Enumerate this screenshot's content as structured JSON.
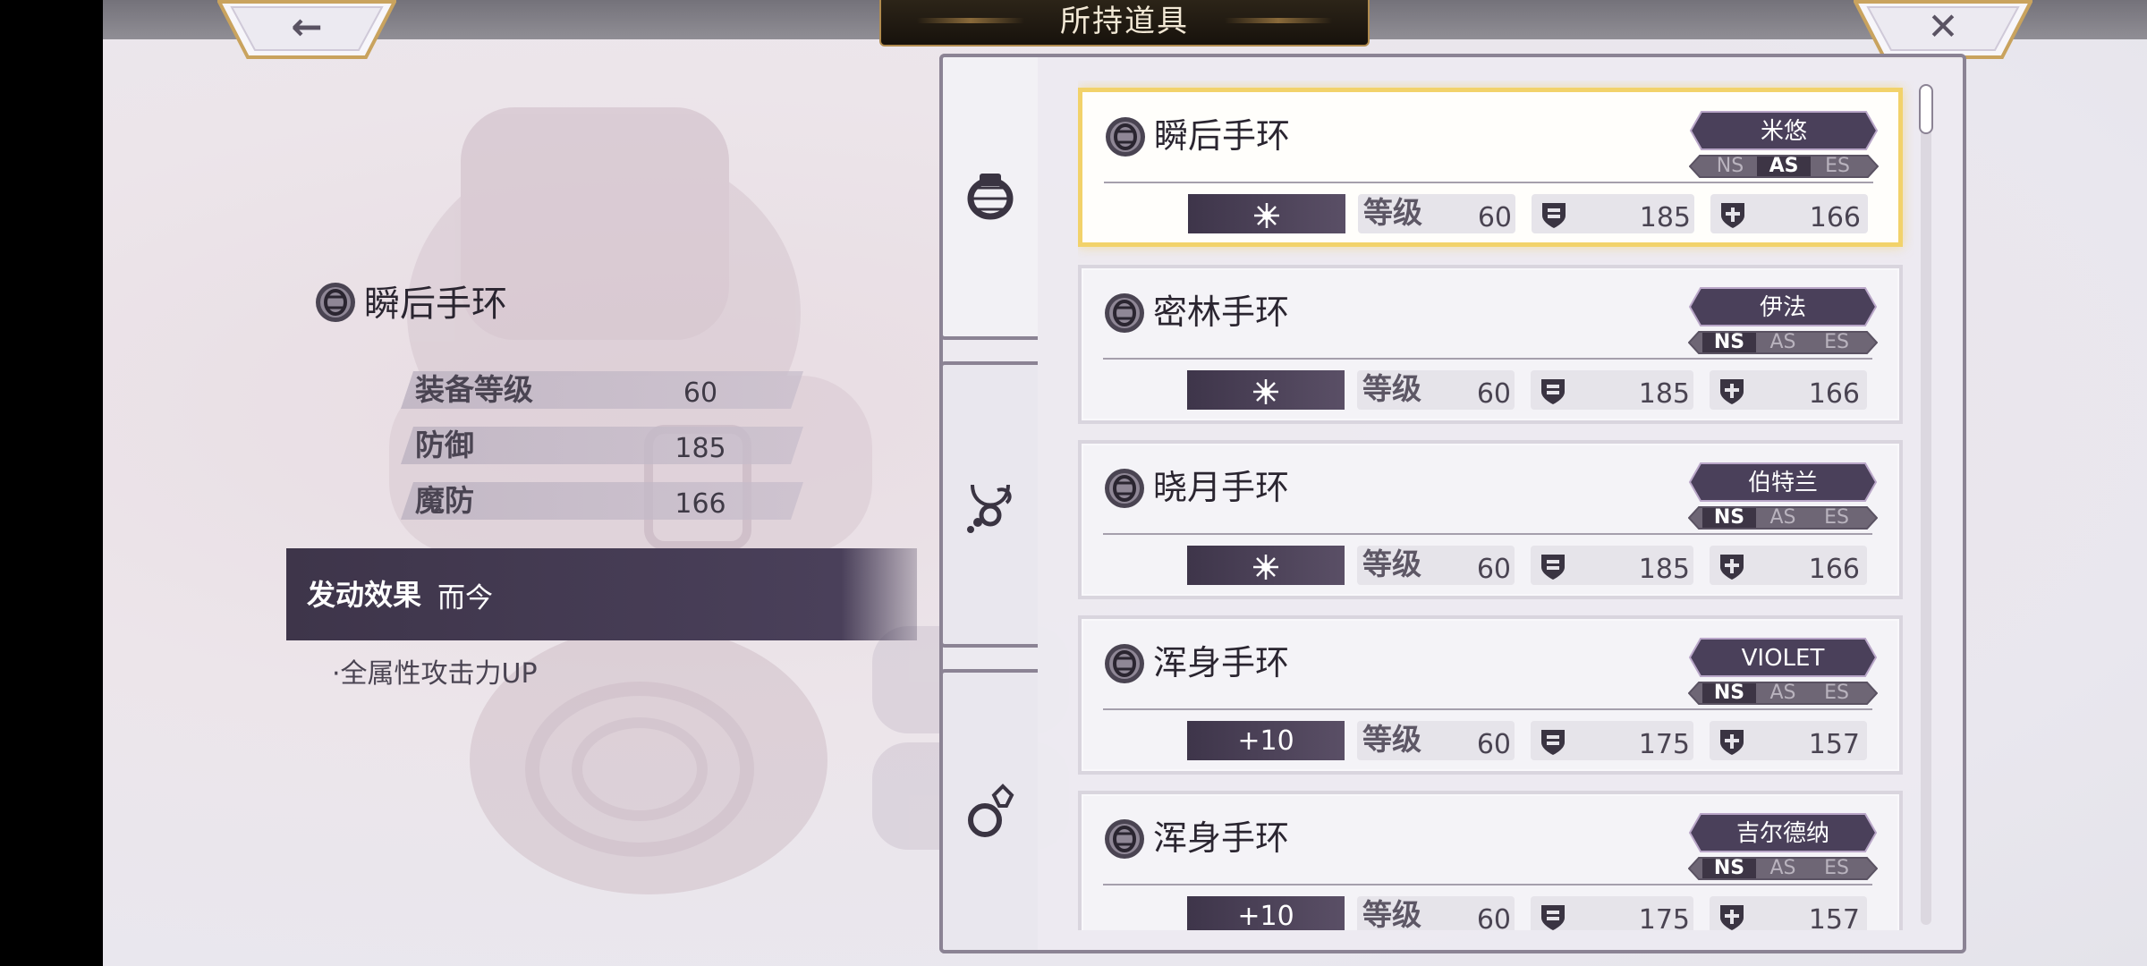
{
  "title": "所持道具",
  "nav": {
    "back_icon": "back-arrow-icon",
    "close_icon": "close-icon",
    "back_glyph": "←",
    "close_glyph": "✕"
  },
  "detail": {
    "name": "瞬后手环",
    "icon": "bracelet-icon",
    "stats": [
      {
        "label": "装备等级",
        "value": "60"
      },
      {
        "label": "防御",
        "value": "185"
      },
      {
        "label": "魔防",
        "value": "166"
      }
    ],
    "effect_label": "发动效果",
    "effect_value": "而今",
    "effect_desc": "·全属性攻击力UP"
  },
  "tabs": [
    {
      "icon": "bracelet-icon",
      "active": true
    },
    {
      "icon": "necklace-icon",
      "active": false
    },
    {
      "icon": "ring-icon",
      "active": false
    }
  ],
  "list": {
    "level_label": "等级",
    "ns": "NS",
    "as": "AS",
    "es": "ES",
    "items": [
      {
        "name": "瞬后手环",
        "owner": "米悠",
        "active_style": "AS",
        "refine": "",
        "refine_icon": "sparkle-icon",
        "level": "60",
        "def": "185",
        "mdef": "166",
        "selected": true
      },
      {
        "name": "密林手环",
        "owner": "伊法",
        "active_style": "NS",
        "refine": "",
        "refine_icon": "sparkle-icon",
        "level": "60",
        "def": "185",
        "mdef": "166",
        "selected": false
      },
      {
        "name": "晓月手环",
        "owner": "伯特兰",
        "active_style": "NS",
        "refine": "",
        "refine_icon": "sparkle-icon",
        "level": "60",
        "def": "185",
        "mdef": "166",
        "selected": false
      },
      {
        "name": "浑身手环",
        "owner": "VIOLET",
        "active_style": "NS",
        "refine": "+10",
        "refine_icon": "",
        "level": "60",
        "def": "175",
        "mdef": "157",
        "selected": false
      },
      {
        "name": "浑身手环",
        "owner": "吉尔德纳",
        "active_style": "NS",
        "refine": "+10",
        "refine_icon": "",
        "level": "60",
        "def": "175",
        "mdef": "157",
        "selected": false
      }
    ]
  },
  "colors": {
    "accent": "#4a405a",
    "selected_border": "#f2d26a",
    "panel_border": "#8b8394",
    "gold": "#b08b4f"
  }
}
